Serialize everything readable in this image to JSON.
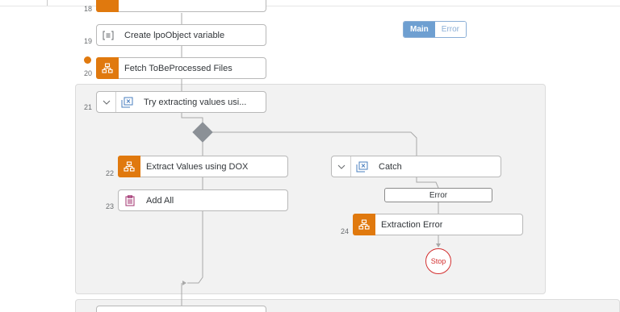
{
  "flow": {
    "toggle": {
      "main_label": "Main",
      "error_label": "Error"
    },
    "steps": [
      {
        "num": "18",
        "label": ""
      },
      {
        "num": "19",
        "label": "Create lpoObject variable"
      },
      {
        "num": "20",
        "label": "Fetch ToBeProcessed Files"
      },
      {
        "num": "21",
        "label": "Try extracting values usi..."
      },
      {
        "num": "22",
        "label": "Extract Values using DOX"
      },
      {
        "num": "23",
        "label": "Add All"
      },
      {
        "num": "",
        "label": "Catch"
      },
      {
        "num": "24",
        "label": "Extraction Error"
      }
    ],
    "error_branch_label": "Error",
    "stop_label": "Stop"
  },
  "colors": {
    "accent_orange": "#e0790e",
    "toggle_blue": "#6e9fd1",
    "stop_red": "#d32f2f"
  },
  "icons": {
    "variable": "bracket-list-icon",
    "subprocess": "hierarchy-icon",
    "try": "try-block-icon",
    "catch": "catch-block-icon",
    "list": "clipboard-list-icon"
  }
}
